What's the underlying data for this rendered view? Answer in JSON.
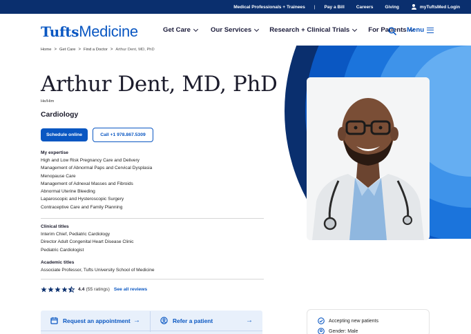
{
  "utility_bar": {
    "links": [
      "Medical Professionals + Trainees",
      "Pay a Bill",
      "Careers",
      "Giving",
      "myTuftsMed Login"
    ],
    "separator": "|"
  },
  "logo": {
    "bold": "Tufts",
    "light": "Medicine"
  },
  "nav": {
    "items": [
      "Get Care",
      "Our Services",
      "Research + Clinical Trials",
      "For Patients"
    ],
    "menu_label": "Menu"
  },
  "breadcrumb": {
    "items": [
      "Home",
      "Get Care",
      "Find a Doctor",
      "Arthur Dent, MD, PhD"
    ],
    "separator": ">"
  },
  "profile": {
    "name": "Arthur Dent, MD, PhD",
    "pronouns": "He/Him",
    "specialty": "Cardiology",
    "schedule_label": "Schedule online",
    "call_label": "Call +1 978.867.5309"
  },
  "expertise": {
    "title": "My expertise",
    "items": [
      "High and Low Risk Pregnancy Care and Delivery",
      "Management of Abnormal Paps and Cervical Dysplasia",
      "Menopause Care",
      "Management of Adnexal Masses and Fibroids",
      "Abnormal Uterine Bleeding",
      "Laparoscopic and Hysteroscopic Surgery",
      "Contraceptive Care and Family Planning"
    ]
  },
  "clinical_titles": {
    "title": "Clinical titles",
    "items": [
      "Interim Chief, Pediatric Cardiology",
      "Director Adult Congenital Heart Disease Clinic",
      "Pediatric Cardiologist"
    ]
  },
  "academic_titles": {
    "title": "Academic titles",
    "items": [
      "Associate Professor, Tufts University School of Medicine"
    ]
  },
  "ratings": {
    "stars_out_of_5": 4.4,
    "value": "4.4",
    "count": "(55 ratings)",
    "see_all": "See all reviews"
  },
  "actions": {
    "request": "Request an appointment",
    "refer": "Refer a patient"
  },
  "info": {
    "accepting": "Accepting new patients",
    "gender": "Gender: Male"
  },
  "colors": {
    "navy": "#0a2f6e",
    "brand_blue": "#0a57c2",
    "light_blue": "#5aa9f2",
    "card_bg": "#e8f0fb"
  },
  "icons": [
    "person-icon",
    "search-icon",
    "hamburger-icon",
    "star-icon",
    "calendar-icon",
    "refer-icon",
    "check-circle-icon",
    "gender-icon"
  ]
}
